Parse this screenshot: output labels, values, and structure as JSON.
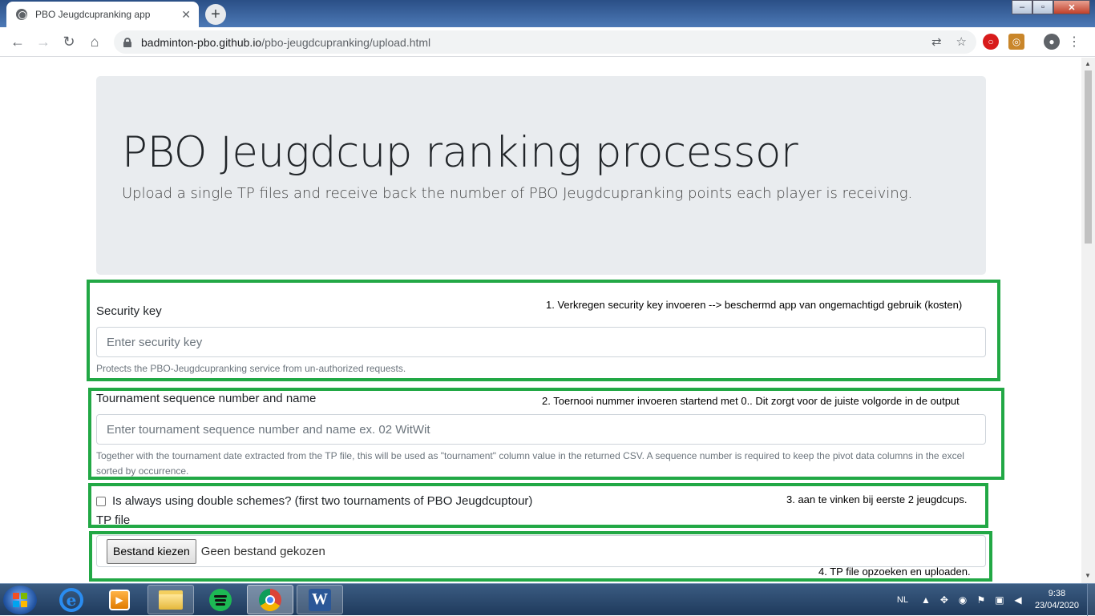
{
  "browser": {
    "tab_title": "PBO Jeugdcupranking app",
    "tab_close": "✕",
    "new_tab": "+",
    "url_host": "badminton-pbo.github.io",
    "url_path": "/pbo-jeugdcupranking/upload.html",
    "window_controls": [
      "–",
      "▫",
      "✕"
    ]
  },
  "page": {
    "title": "PBO Jeugdcup ranking processor",
    "lead": "Upload a single TP files and receive back the number of PBO Jeugdcupranking points each player is receiving.",
    "security": {
      "label": "Security key",
      "placeholder": "Enter security key",
      "help": "Protects the PBO-Jeugdcupranking service from un-authorized requests."
    },
    "tournament": {
      "label": "Tournament sequence number and name",
      "placeholder": "Enter tournament sequence number and name ex. 02 WitWit",
      "help": "Together with the tournament date extracted from the TP file, this will be used as \"tournament\" column value in the returned CSV. A sequence number is required to keep the pivot data columns in the excel sorted by occurrence."
    },
    "double_schemes": {
      "label": "Is always using double schemes? (first two tournaments of PBO Jeugdcuptour)",
      "checked": false
    },
    "tp_file": {
      "label": "TP file",
      "button": "Bestand kiezen",
      "status": "Geen bestand gekozen"
    }
  },
  "annotations": {
    "note1": "1. Verkregen security key invoeren --> beschermd app van ongemachtigd gebruik (kosten)",
    "note2": "2. Toernooi nummer invoeren startend met 0.. Dit zorgt voor de juiste volgorde in de output",
    "note3": "3. aan te vinken bij eerste 2 jeugdcups.",
    "note4": "4. TP file opzoeken en uploaden."
  },
  "taskbar": {
    "language": "NL",
    "time": "9:38",
    "date": "23/04/2020"
  },
  "colors": {
    "annotation_box": "#22a845",
    "jumbotron_bg": "#e9ecef"
  }
}
